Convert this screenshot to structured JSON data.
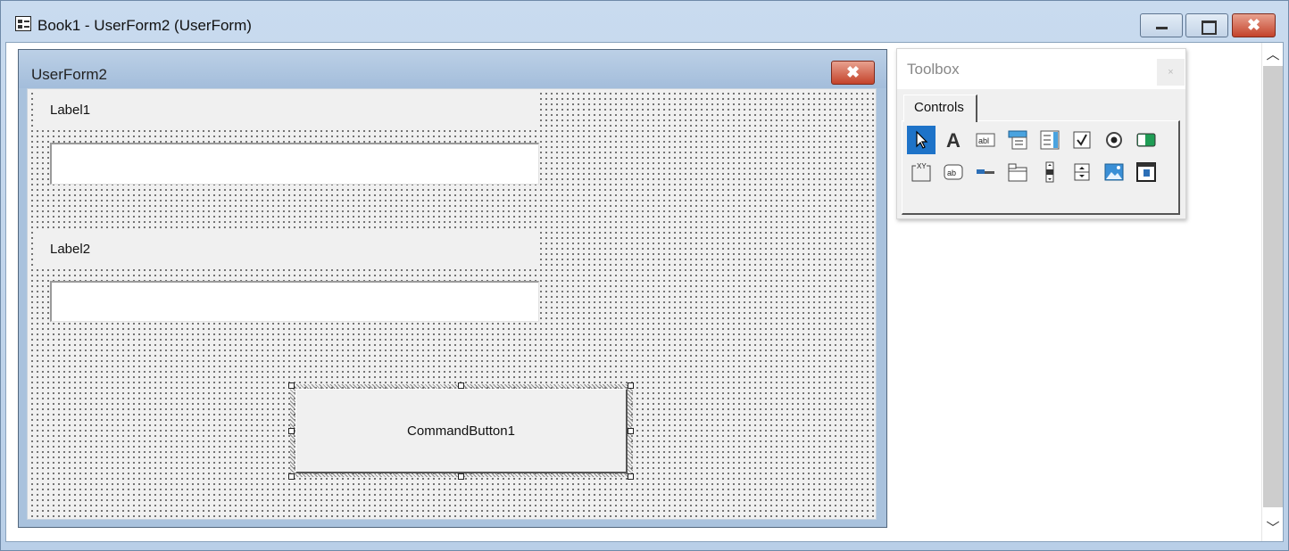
{
  "window": {
    "title": "Book1 - UserForm2 (UserForm)",
    "close_glyph": "✖"
  },
  "userform": {
    "title": "UserForm2",
    "close_glyph": "✖",
    "label1": "Label1",
    "label2": "Label2",
    "command_button": "CommandButton1"
  },
  "toolbox": {
    "title": "Toolbox",
    "close_glyph": "×",
    "tab": "Controls",
    "tools": [
      "select-objects-icon",
      "label-icon",
      "textbox-icon",
      "combobox-icon",
      "listbox-icon",
      "checkbox-icon",
      "optionbutton-icon",
      "togglebutton-icon",
      "frame-icon",
      "commandbutton-icon",
      "tabstrip-icon",
      "multipage-icon",
      "scrollbar-icon",
      "spinbutton-icon",
      "image-icon",
      "refedit-icon"
    ]
  },
  "scrollbar": {
    "up_glyph": "︿",
    "down_glyph": "﹀"
  }
}
